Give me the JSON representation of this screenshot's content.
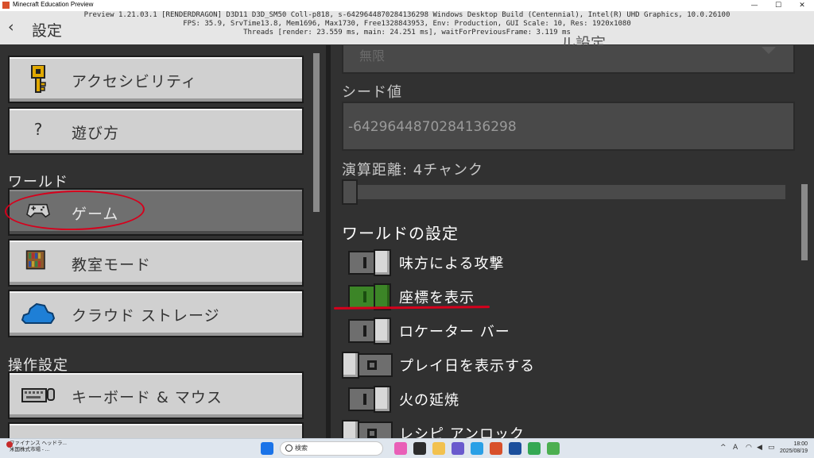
{
  "window": {
    "title": "Minecraft Education Preview",
    "controls": [
      "—",
      "☐",
      "✕"
    ]
  },
  "header": {
    "back_icon": "chevron-left-icon",
    "title": "設定",
    "right_title": "ル設定"
  },
  "debug_overlay": {
    "line1": "Preview 1.21.03.1 [RENDERDRAGON] D3D11 D3D_SM50 Coll-p818, s-6429644870284136298 Windows Desktop Build (Centennial), Intel(R) UHD Graphics, 10.0.26100",
    "line2": "FPS: 35.9, SrvTime13.8, Mem1696, Max1730, Free1328843953, Env: Production, GUI Scale: 10, Res: 1920x1080",
    "line3": "Threads [render: 23.559 ms, main: 24.251 ms], waitForPreviousFrame: 3.119 ms"
  },
  "sidebar": {
    "items_top": [
      {
        "label": "アクセシビリティ",
        "icon": "key-icon"
      },
      {
        "label": "遊び方",
        "icon": "question-icon"
      }
    ],
    "world_section": "ワールド",
    "world_items": [
      {
        "label": "ゲーム",
        "icon": "controller-icon",
        "selected": true
      },
      {
        "label": "教室モード",
        "icon": "bookshelf-icon"
      },
      {
        "label": "クラウド ストレージ",
        "icon": "cloud-icon"
      }
    ],
    "controls_section": "操作設定",
    "controls_items": [
      {
        "label": "キーボード & マウス",
        "icon": "keyboard-icon"
      }
    ]
  },
  "main": {
    "dropdown_value": "無限",
    "seed_label": "シード値",
    "seed_value": "-6429644870284136298",
    "simulation_label": "演算距離: 4チャンク",
    "world_settings_title": "ワールドの設定",
    "toggles": [
      {
        "label": "味方による攻撃",
        "state": "off"
      },
      {
        "label": "座標を表示",
        "state": "on"
      },
      {
        "label": "ロケーター バー",
        "state": "off"
      },
      {
        "label": "プレイ日を表示する",
        "state": "off-left"
      },
      {
        "label": "火の延焼",
        "state": "off"
      },
      {
        "label": "レシピ アンロック",
        "state": "off-left"
      }
    ]
  },
  "taskbar": {
    "notification_badge": "3",
    "notification_line1": "ファイナンス ヘッドラ...",
    "notification_line2": "米国株式市場 - ...",
    "search_placeholder": "検索",
    "clock_time": "18:00",
    "clock_date": "2025/08/19",
    "tray_ime": "A"
  },
  "colors": {
    "toggle_on": "#3c8527",
    "annotation_red": "#d6001c",
    "panel_bg": "#313131",
    "button_bg": "#d0d0d0"
  }
}
